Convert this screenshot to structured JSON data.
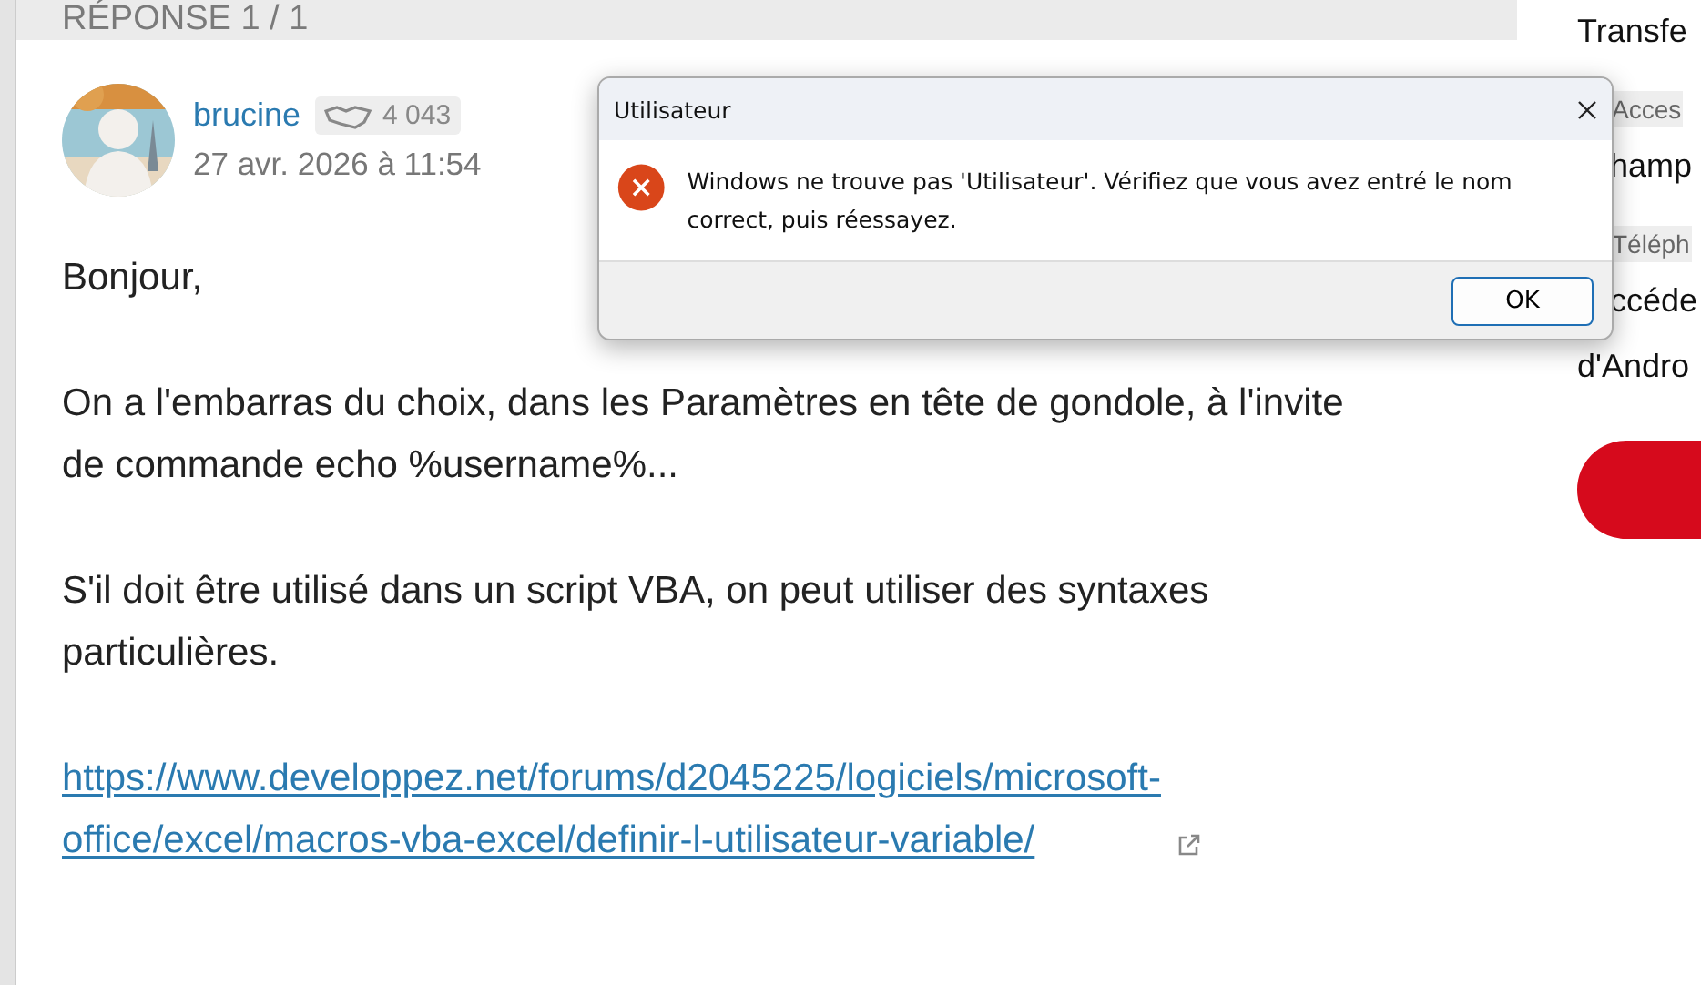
{
  "post": {
    "header": "RÉPONSE 1 / 1",
    "author": "brucine",
    "reputation": "4 043",
    "date": "27 avr. 2026 à 11:54",
    "paragraphs": [
      "Bonjour,",
      "On a l'embarras du choix, dans les Paramètres en tête de gondole, à l'invite de commande echo %username%...",
      "S'il doit être utilisé dans un script VBA, on peut utiliser des syntaxes particulières."
    ],
    "link": "https://www.developpez.net/forums/d2045225/logiciels/microsoft-office/excel/macros-vba-excel/definir-l-utilisateur-variable/"
  },
  "sidebar": [
    {
      "kind": "text",
      "text": "Transfe"
    },
    {
      "kind": "tag",
      "text": "Acces"
    },
    {
      "kind": "text",
      "text": "hamp"
    },
    {
      "kind": "tag",
      "text": "Téléph"
    },
    {
      "kind": "text",
      "text": "ccéde"
    },
    {
      "kind": "text",
      "text": "d'Andro"
    },
    {
      "kind": "button"
    }
  ],
  "dialog": {
    "title": "Utilisateur",
    "message": "Windows ne trouve pas 'Utilisateur'. Vérifiez que vous avez entré le nom correct, puis réessayez.",
    "buttons": [
      "OK"
    ]
  }
}
